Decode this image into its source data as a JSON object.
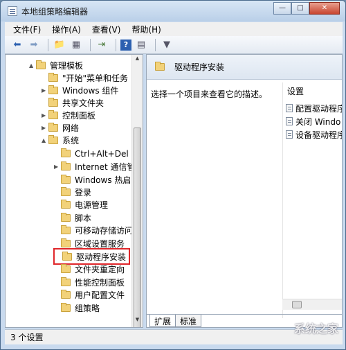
{
  "window": {
    "title": "本地组策略编辑器",
    "min": "—",
    "max": "□",
    "close": "✕"
  },
  "menu": [
    "文件(F)",
    "操作(A)",
    "查看(V)",
    "帮助(H)"
  ],
  "tree": [
    {
      "label": "管理模板",
      "arrow": "▲"
    },
    {
      "label": "\"开始\"菜单和任务",
      "arrow": ""
    },
    {
      "label": "Windows 组件",
      "arrow": "▶"
    },
    {
      "label": "共享文件夹",
      "arrow": ""
    },
    {
      "label": "控制面板",
      "arrow": "▶"
    },
    {
      "label": "网络",
      "arrow": "▶"
    },
    {
      "label": "系统",
      "arrow": "▲"
    },
    {
      "label": "Ctrl+Alt+Del 选",
      "arrow": ""
    },
    {
      "label": "Internet 通信管理",
      "arrow": "▶"
    },
    {
      "label": "Windows 热启动",
      "arrow": ""
    },
    {
      "label": "登录",
      "arrow": ""
    },
    {
      "label": "电源管理",
      "arrow": ""
    },
    {
      "label": "脚本",
      "arrow": ""
    },
    {
      "label": "可移动存储访问",
      "arrow": ""
    },
    {
      "label": "区域设置服务",
      "arrow": ""
    },
    {
      "label": "驱动程序安装",
      "arrow": "",
      "selected": true
    },
    {
      "label": "文件夹重定向",
      "arrow": ""
    },
    {
      "label": "性能控制面板",
      "arrow": ""
    },
    {
      "label": "用户配置文件",
      "arrow": ""
    },
    {
      "label": "组策略",
      "arrow": ""
    }
  ],
  "right": {
    "header": "驱动程序安装",
    "description": "选择一个项目来查看它的描述。",
    "settings_header": "设置",
    "settings": [
      "配置驱动程序",
      "关闭 Windo",
      "设备驱动程序"
    ]
  },
  "tabs": [
    "扩展",
    "标准"
  ],
  "status": "3 个设置",
  "watermark": "系统之家"
}
